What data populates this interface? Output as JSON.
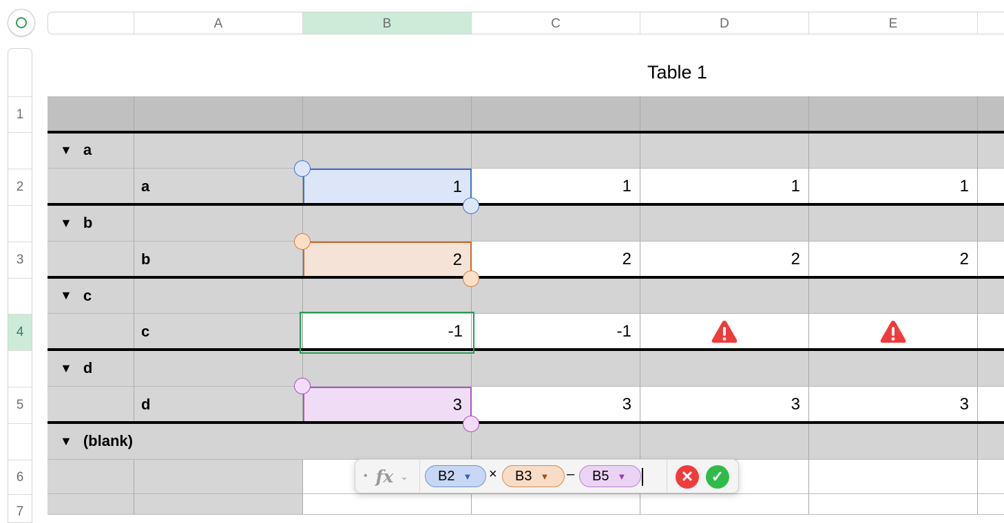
{
  "columns": [
    "A",
    "B",
    "C",
    "D",
    "E"
  ],
  "rows": [
    "1",
    "2",
    "3",
    "4",
    "5",
    "6",
    "7"
  ],
  "table_title": "Table 1",
  "groups": [
    {
      "label": "a",
      "row_label": "a",
      "values": [
        "1",
        "1",
        "1",
        "1"
      ]
    },
    {
      "label": "b",
      "row_label": "b",
      "values": [
        "2",
        "2",
        "2",
        "2"
      ]
    },
    {
      "label": "c",
      "row_label": "c",
      "values": [
        "-1",
        "-1",
        "",
        ""
      ]
    },
    {
      "label": "d",
      "row_label": "d",
      "values": [
        "3",
        "3",
        "3",
        "3"
      ]
    },
    {
      "label": "(blank)"
    }
  ],
  "group_toggle_glyph": "▼",
  "warning_icons": [
    "warning-triangle-icon",
    "warning-triangle-icon"
  ],
  "formula": {
    "fx_symbol": "fx",
    "tokens": [
      {
        "ref": "B2",
        "arrow": "▼"
      },
      {
        "ref": "B3",
        "arrow": "▼"
      },
      {
        "ref": "B5",
        "arrow": "▼"
      }
    ],
    "operators": [
      "×",
      "–"
    ],
    "cancel_glyph": "✕",
    "accept_glyph": "✓"
  },
  "colors": {
    "selection_green": "#2a9a52",
    "ref_blue": "#3c6fd6",
    "ref_orange": "#c8672a",
    "ref_purple": "#aa55c4",
    "warning_red": "#ef3b3b"
  }
}
